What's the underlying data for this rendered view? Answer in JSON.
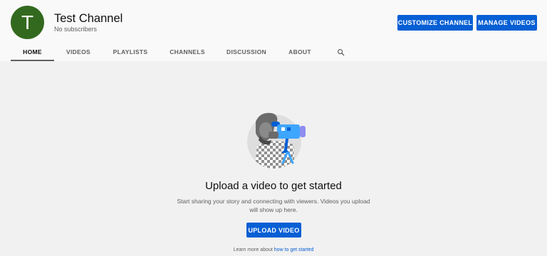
{
  "channel": {
    "avatar_letter": "T",
    "avatar_color": "#33691e",
    "name": "Test Channel",
    "subscribers": "No subscribers"
  },
  "header_buttons": {
    "customize": "CUSTOMIZE CHANNEL",
    "manage": "MANAGE VIDEOS"
  },
  "tabs": [
    {
      "label": "HOME",
      "active": true
    },
    {
      "label": "VIDEOS"
    },
    {
      "label": "PLAYLISTS"
    },
    {
      "label": "CHANNELS"
    },
    {
      "label": "DISCUSSION"
    },
    {
      "label": "ABOUT"
    }
  ],
  "search_icon": "search-icon",
  "empty_state": {
    "title": "Upload a video to get started",
    "description": "Start sharing your story and connecting with viewers. Videos you upload will show up here.",
    "upload_button": "UPLOAD VIDEO",
    "learn_prefix": "Learn more about",
    "learn_link": "how to get started"
  },
  "colors": {
    "accent": "#065fd4",
    "background": "#f1f1f1",
    "header": "#f9f9f9"
  }
}
